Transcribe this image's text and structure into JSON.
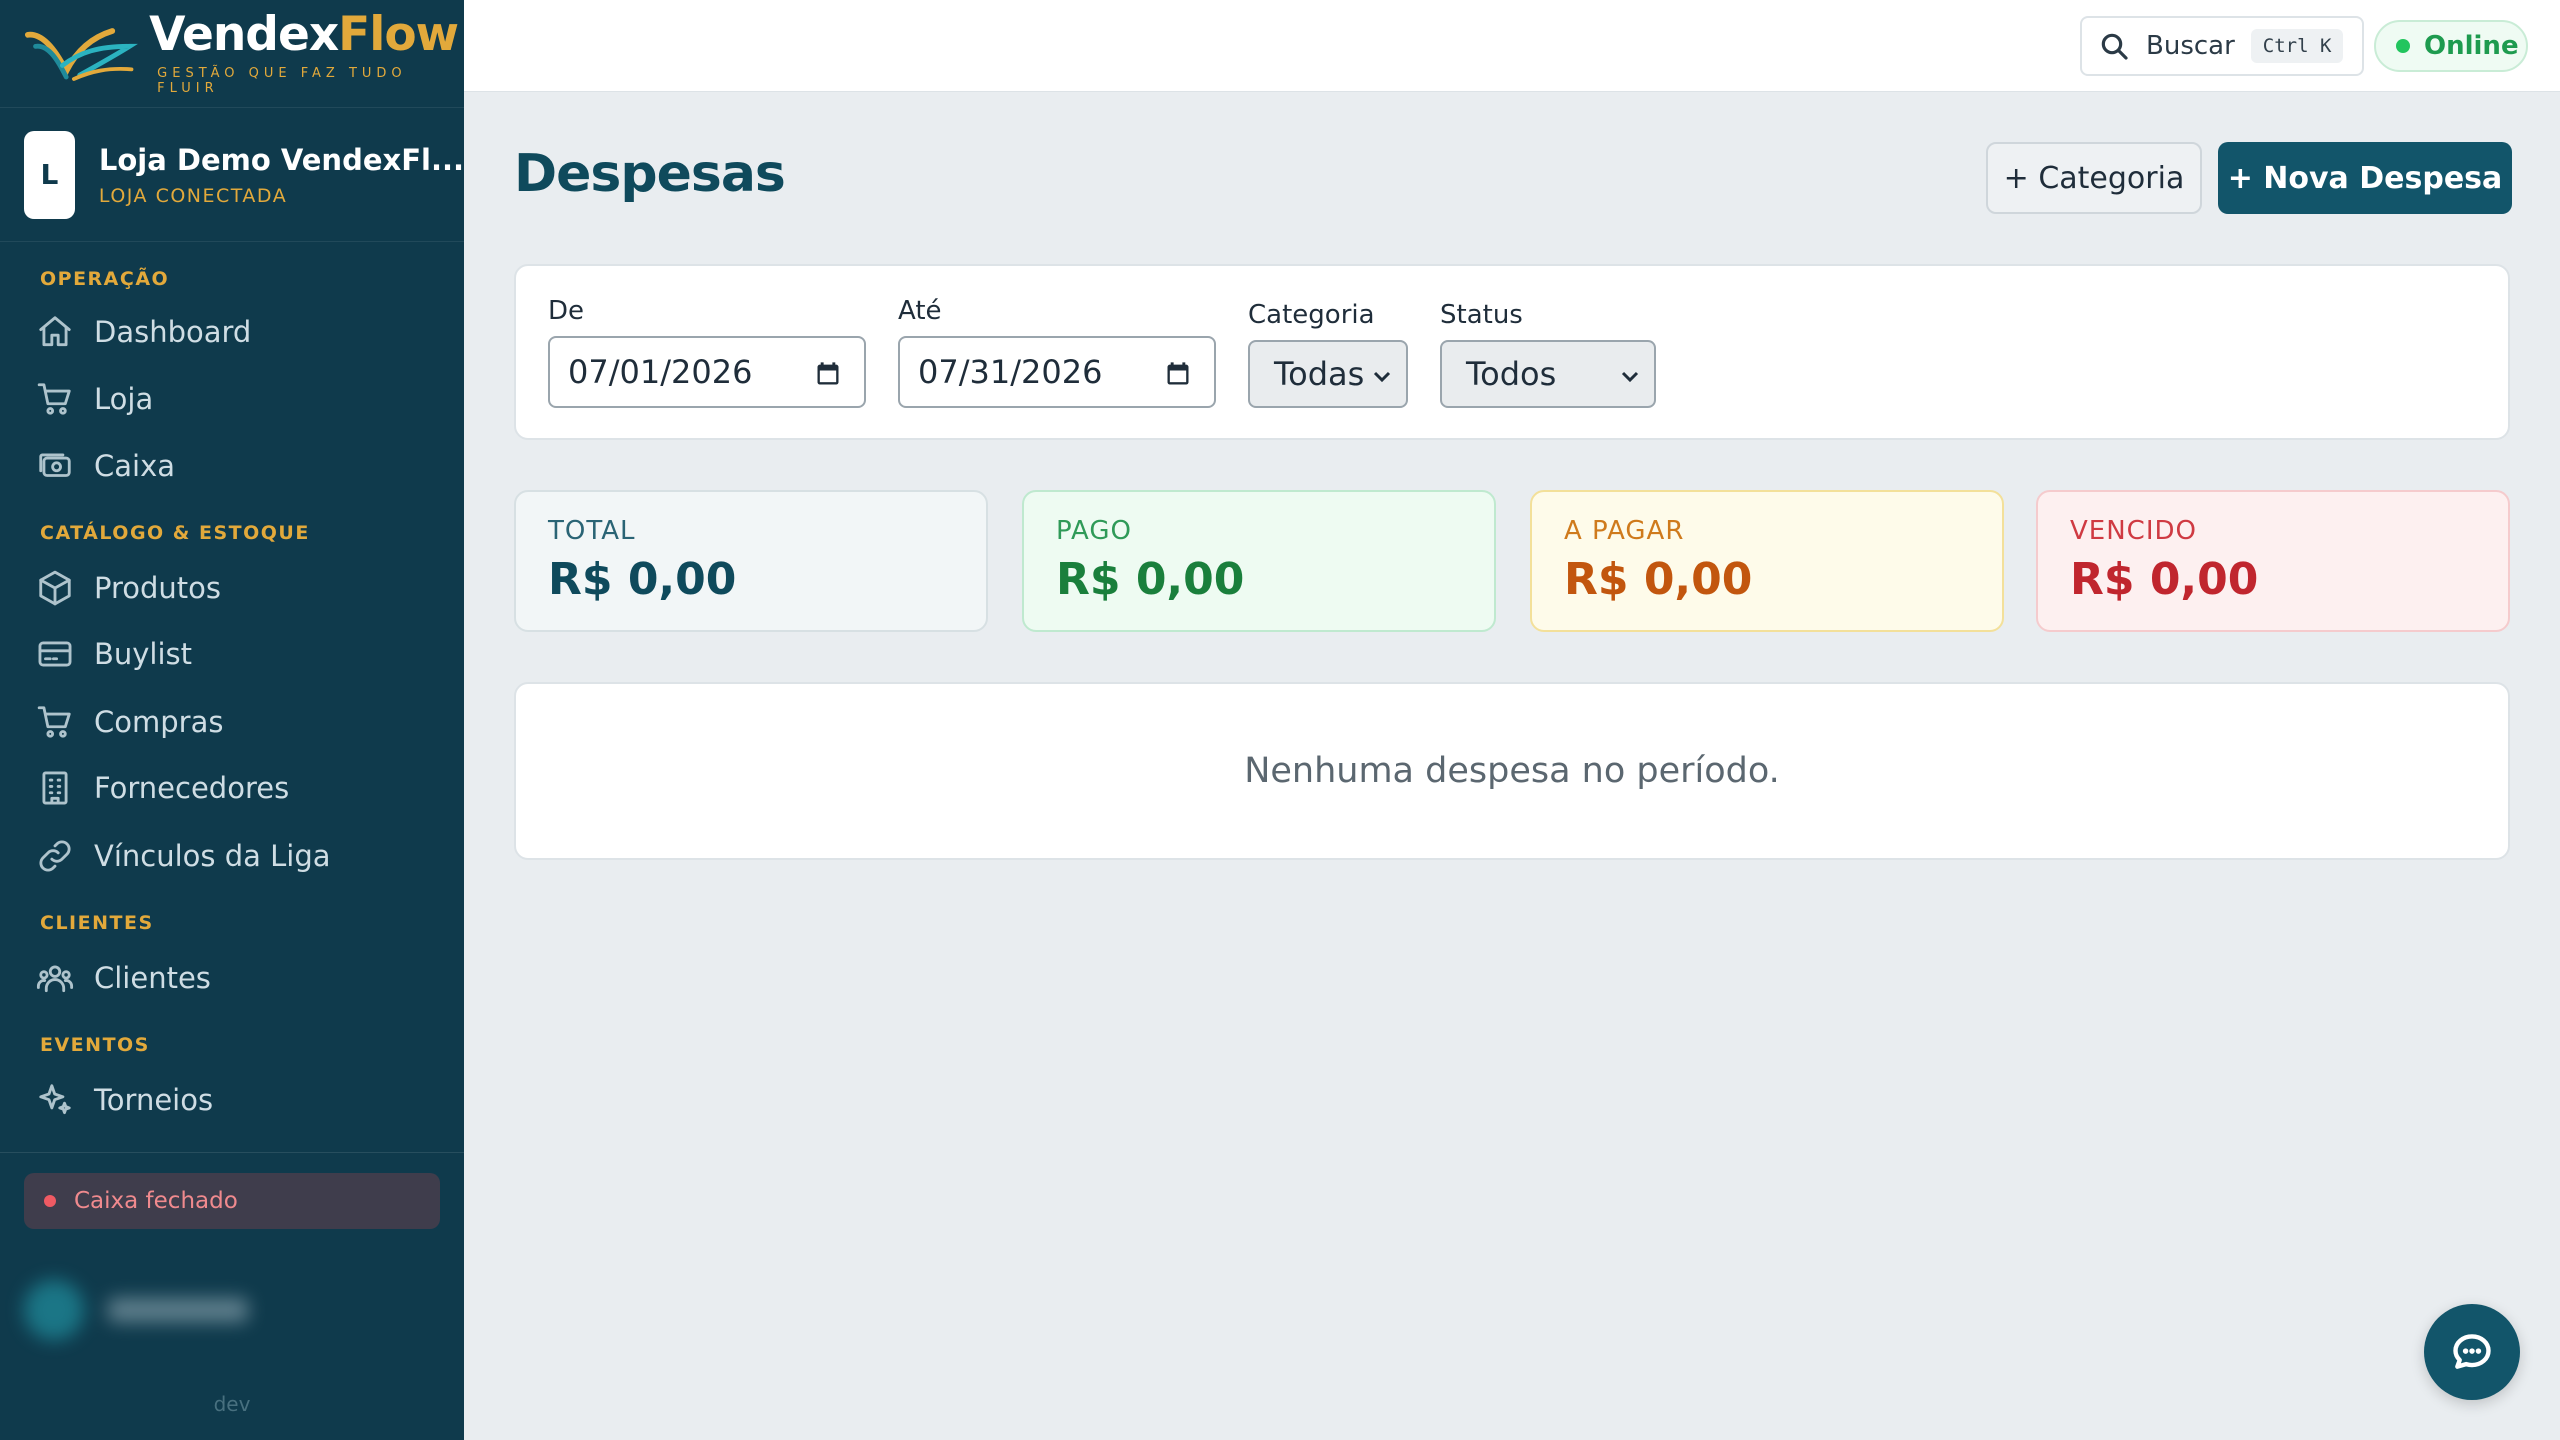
{
  "brand": {
    "name_part1": "Vendex",
    "name_part2": "Flow",
    "tagline": "GESTÃO QUE FAZ TUDO FLUIR"
  },
  "store": {
    "avatar_letter": "L",
    "name": "Loja Demo VendexFl...",
    "status": "LOJA CONECTADA"
  },
  "sidebar": {
    "sections": [
      {
        "title": "OPERAÇÃO"
      },
      {
        "title": "CATÁLOGO & ESTOQUE"
      },
      {
        "title": "CLIENTES"
      },
      {
        "title": "EVENTOS"
      }
    ],
    "items": [
      {
        "label": "Dashboard",
        "icon": "home-icon"
      },
      {
        "label": "Loja",
        "icon": "cart-icon"
      },
      {
        "label": "Caixa",
        "icon": "cash-icon"
      },
      {
        "label": "Produtos",
        "icon": "box-icon"
      },
      {
        "label": "Buylist",
        "icon": "card-icon"
      },
      {
        "label": "Compras",
        "icon": "cart-icon"
      },
      {
        "label": "Fornecedores",
        "icon": "building-icon"
      },
      {
        "label": "Vínculos da Liga",
        "icon": "link-icon"
      },
      {
        "label": "Clientes",
        "icon": "users-icon"
      },
      {
        "label": "Torneios",
        "icon": "sparkle-icon"
      }
    ],
    "cash_status": "Caixa fechado",
    "env": "dev"
  },
  "topbar": {
    "search_label": "Buscar",
    "search_shortcut": "Ctrl K",
    "connection": "Online"
  },
  "page": {
    "title": "Despesas",
    "add_category_label": "+ Categoria",
    "new_expense_label": "+ Nova Despesa"
  },
  "filters": {
    "from_label": "De",
    "from_value": "07/01/2026",
    "to_label": "Até",
    "to_value": "07/31/2026",
    "category_label": "Categoria",
    "category_value": "Todas",
    "status_label": "Status",
    "status_value": "Todos"
  },
  "summary": [
    {
      "label": "TOTAL",
      "value": "R$ 0,00"
    },
    {
      "label": "PAGO",
      "value": "R$ 0,00"
    },
    {
      "label": "A PAGAR",
      "value": "R$ 0,00"
    },
    {
      "label": "VENCIDO",
      "value": "R$ 0,00"
    }
  ],
  "colors": {
    "sidebar_bg": "#0f3a4c",
    "accent": "#e2a93b",
    "primary": "#12556a",
    "total": "#0f4a5c",
    "paid": "#1a7f3c",
    "to_pay": "#c2560e",
    "overdue": "#c0262e"
  },
  "empty_message": "Nenhuma despesa no período."
}
